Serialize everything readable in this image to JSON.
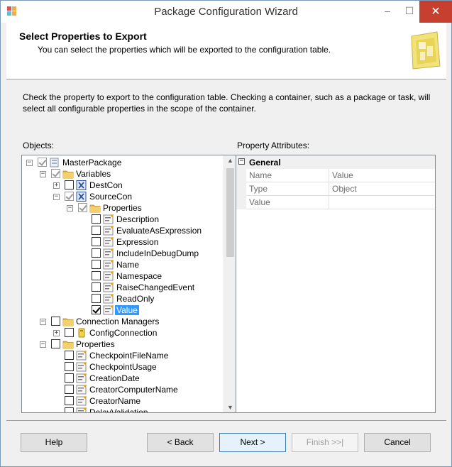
{
  "window": {
    "title": "Package Configuration Wizard",
    "minimize_glyph": "‒",
    "maximize_glyph": "☐",
    "close_glyph": "✕"
  },
  "header": {
    "title": "Select Properties to Export",
    "subtitle": "You can select the properties which will be exported to the configuration table."
  },
  "content": {
    "instructions": "Check the property to export to the configuration table. Checking a container, such as a package or task, will select all configurable properties in the scope of the container.",
    "objects_label": "Objects:",
    "property_attributes_label": "Property Attributes:"
  },
  "tree": {
    "nodes": [
      {
        "label": "MasterPackage",
        "expander": "−",
        "check": "grayed",
        "icon": "package-icon",
        "selected": false
      },
      {
        "label": "Variables",
        "expander": "−",
        "check": "grayed",
        "icon": "folder-icon",
        "selected": false
      },
      {
        "label": "DestCon",
        "expander": "+",
        "check": "unchecked",
        "icon": "variable-icon",
        "selected": false
      },
      {
        "label": "SourceCon",
        "expander": "−",
        "check": "grayed",
        "icon": "variable-icon",
        "selected": false
      },
      {
        "label": "Properties",
        "expander": "−",
        "check": "grayed",
        "icon": "folder-icon",
        "selected": false
      },
      {
        "label": "Description",
        "expander": "",
        "check": "unchecked",
        "icon": "property-icon",
        "selected": false
      },
      {
        "label": "EvaluateAsExpression",
        "expander": "",
        "check": "unchecked",
        "icon": "property-icon",
        "selected": false
      },
      {
        "label": "Expression",
        "expander": "",
        "check": "unchecked",
        "icon": "property-icon",
        "selected": false
      },
      {
        "label": "IncludeInDebugDump",
        "expander": "",
        "check": "unchecked",
        "icon": "property-icon",
        "selected": false
      },
      {
        "label": "Name",
        "expander": "",
        "check": "unchecked",
        "icon": "property-icon",
        "selected": false
      },
      {
        "label": "Namespace",
        "expander": "",
        "check": "unchecked",
        "icon": "property-icon",
        "selected": false
      },
      {
        "label": "RaiseChangedEvent",
        "expander": "",
        "check": "unchecked",
        "icon": "property-icon",
        "selected": false
      },
      {
        "label": "ReadOnly",
        "expander": "",
        "check": "unchecked",
        "icon": "property-icon",
        "selected": false
      },
      {
        "label": "Value",
        "expander": "",
        "check": "checked",
        "icon": "property-icon",
        "selected": true
      },
      {
        "label": "Connection Managers",
        "expander": "−",
        "check": "unchecked",
        "icon": "folder-icon",
        "selected": false
      },
      {
        "label": "ConfigConnection",
        "expander": "+",
        "check": "unchecked",
        "icon": "connection-icon",
        "selected": false
      },
      {
        "label": "Properties",
        "expander": "−",
        "check": "unchecked",
        "icon": "folder-icon",
        "selected": false
      },
      {
        "label": "CheckpointFileName",
        "expander": "",
        "check": "unchecked",
        "icon": "property-icon",
        "selected": false
      },
      {
        "label": "CheckpointUsage",
        "expander": "",
        "check": "unchecked",
        "icon": "property-icon",
        "selected": false
      },
      {
        "label": "CreationDate",
        "expander": "",
        "check": "unchecked",
        "icon": "property-icon",
        "selected": false
      },
      {
        "label": "CreatorComputerName",
        "expander": "",
        "check": "unchecked",
        "icon": "property-icon",
        "selected": false
      },
      {
        "label": "CreatorName",
        "expander": "",
        "check": "unchecked",
        "icon": "property-icon",
        "selected": false
      },
      {
        "label": "DelayValidation",
        "expander": "",
        "check": "unchecked",
        "icon": "property-icon",
        "selected": false
      }
    ]
  },
  "property_grid": {
    "category": "General",
    "category_toggle": "−",
    "rows": [
      {
        "name": "Name",
        "value": "Value"
      },
      {
        "name": "Type",
        "value": "Object"
      },
      {
        "name": "Value",
        "value": ""
      }
    ]
  },
  "footer": {
    "help": "Help",
    "back": "< Back",
    "next": "Next >",
    "finish": "Finish >>|",
    "cancel": "Cancel"
  },
  "colors": {
    "selection": "#3399ff",
    "close_button": "#c7402f",
    "folder": "#e8b84a"
  }
}
